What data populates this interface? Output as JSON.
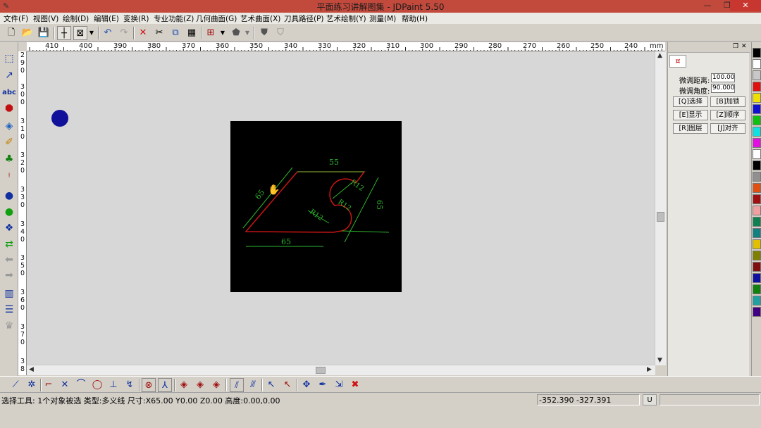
{
  "window": {
    "title": "平面练习讲解图集 - JDPaint 5.50",
    "minimize": "—",
    "restore": "❐",
    "close": "✕"
  },
  "menu": [
    "文件(F)",
    "视图(V)",
    "绘制(D)",
    "编辑(E)",
    "变换(R)",
    "专业功能(Z)",
    "几何曲面(G)",
    "艺术曲面(X)",
    "刀具路径(P)",
    "艺术绘制(Y)",
    "测量(M)",
    "帮助(H)"
  ],
  "toolbar_icons": [
    "new-file-icon",
    "open-folder-icon",
    "save-icon",
    "crosshair-icon",
    "box-select-icon",
    "dropdown-arrow-icon",
    "undo-icon",
    "redo-icon",
    "delete-icon",
    "cut-icon",
    "copy-icon",
    "paste-icon",
    "grid-icon",
    "dropdown-arrow-icon",
    "solid-shape-icon",
    "dropdown-arrow-icon",
    "shield-icon",
    "shield-gray-icon"
  ],
  "ruler_top": {
    "labels": [
      "410",
      "400",
      "390",
      "380",
      "370",
      "360",
      "350",
      "340",
      "330",
      "320",
      "310",
      "300",
      "290",
      "280",
      "270",
      "260",
      "250",
      "240",
      "mm"
    ]
  },
  "ruler_left": {
    "labels": [
      "2",
      "9",
      "0",
      "3",
      "0",
      "0",
      "3",
      "1",
      "0",
      "3",
      "2",
      "0",
      "3",
      "3",
      "0",
      "3",
      "4",
      "0",
      "3",
      "5",
      "0",
      "3",
      "6",
      "0",
      "3",
      "7",
      "0",
      "3",
      "8"
    ]
  },
  "drawing": {
    "dim_top": "55",
    "dim_bottom": "65",
    "dim_left": "65",
    "dim_right": "65",
    "radius_top": "R12",
    "radius_mid": "R12",
    "radius_left": "R12",
    "colors": {
      "background": "#000000",
      "outline": "#c81414",
      "dimension": "#2fb52f"
    }
  },
  "panel": {
    "tab_icon": "¤",
    "fine_distance_label": "微调距离:",
    "fine_distance_value": "100.00",
    "fine_angle_label": "微调角度:",
    "fine_angle_value": "90.000",
    "buttons": [
      "[Q]选择",
      "[B]加锁",
      "[E]显示",
      "[Z]顺序",
      "[R]图层",
      "[J]对齐"
    ]
  },
  "palette": [
    "#000000",
    "#ffffff",
    "#c8c8c8",
    "#e01010",
    "#f0e000",
    "#1010d0",
    "#10c010",
    "#10e0e0",
    "#e010e0",
    "#ffffff",
    "#000000",
    "#909090",
    "#e05010",
    "#a01010",
    "#f0a0a0",
    "#108050",
    "#108080",
    "#e0c000",
    "#808000",
    "#801010",
    "#1010a0",
    "#108010",
    "#20a0a0",
    "#400080"
  ],
  "status": {
    "main": "选择工具: 1个对象被选 类型:多义线 尺寸:X65.00 Y0.00 Z0.00 高度:0.00,0.00",
    "coords": "-352.390 -327.391",
    "unit": "U"
  }
}
